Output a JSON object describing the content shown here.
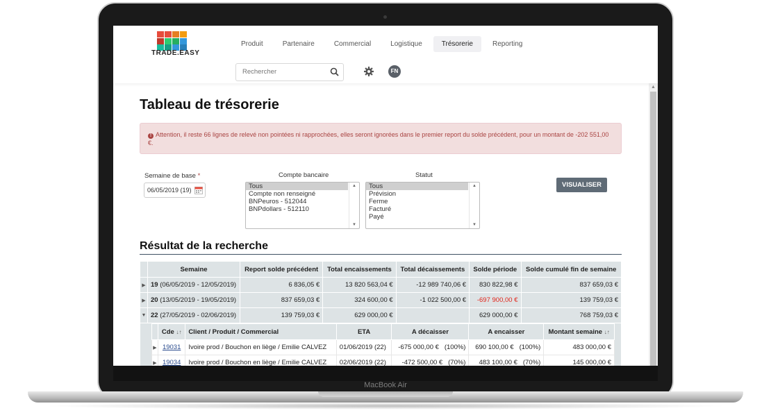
{
  "device": {
    "brand_label": "MacBook Air"
  },
  "logo": {
    "text": "TRADE.EASY",
    "colors": [
      "#e74c3c",
      "#e74c3c",
      "#e67e22",
      "#f39c12",
      "#c0392b",
      "#2ecc71",
      "#27ae60",
      "#3498db",
      "#1abc9c",
      "#16a085",
      "#3498db",
      "#2980b9"
    ]
  },
  "nav": {
    "tabs": [
      {
        "label": "Produit"
      },
      {
        "label": "Partenaire"
      },
      {
        "label": "Commercial"
      },
      {
        "label": "Logistique"
      },
      {
        "label": "Trésorerie",
        "active": true
      },
      {
        "label": "Reporting"
      }
    ]
  },
  "search": {
    "placeholder": "Rechercher"
  },
  "user": {
    "initials": "FN"
  },
  "page": {
    "title": "Tableau de trésorerie"
  },
  "alert": {
    "text": "Attention, il reste 66 lignes de relevé non pointées ni rapprochées, elles seront ignorées dans le premier report du solde précédent, pour un montant de -202 551,00 €."
  },
  "filters": {
    "semaine_label": "Semaine de base",
    "required_mark": "*",
    "semaine_value": "06/05/2019 (19)",
    "compte_label": "Compte bancaire",
    "compte_options": [
      "Tous",
      "Compte non renseigné",
      "BNPeuros - 512044",
      "BNPdollars - 512110"
    ],
    "statut_label": "Statut",
    "statut_options": [
      "Tous",
      "Prévision",
      "Ferme",
      "Facturé",
      "Payé"
    ],
    "button_label": "VISUALISER"
  },
  "results": {
    "title": "Résultat de la recherche",
    "columns": [
      "Semaine",
      "Report solde précédent",
      "Total encaissements",
      "Total décaissements",
      "Solde période",
      "Solde cumulé fin de semaine"
    ],
    "rows": [
      {
        "week": "19",
        "range": "(06/05/2019 - 12/05/2019)",
        "report": "6 836,05 €",
        "enc": "13 820 563,04 €",
        "dec": "-12 989 740,06 €",
        "solde": "830 822,98 €",
        "cumul": "837 659,03 €",
        "negative": false
      },
      {
        "week": "20",
        "range": "(13/05/2019 - 19/05/2019)",
        "report": "837 659,03 €",
        "enc": "324 600,00 €",
        "dec": "-1 022 500,00 €",
        "solde": "-697 900,00 €",
        "cumul": "139 759,03 €",
        "negative": true
      },
      {
        "week": "22",
        "range": "(27/05/2019 - 02/06/2019)",
        "report": "139 759,03 €",
        "enc": "629 000,00 €",
        "dec": "",
        "solde": "629 000,00 €",
        "cumul": "768 759,03 €",
        "negative": false
      }
    ],
    "detail": {
      "columns": [
        "Cde",
        "Client / Produit / Commercial",
        "ETA",
        "A décaisser",
        "A encaisser",
        "Montant semaine"
      ],
      "sort_icon": "↓↑",
      "rows": [
        {
          "cde": "19031",
          "client": "Ivoire prod / Bouchon en liège / Emilie CALVEZ",
          "eta": "01/06/2019 (22)",
          "dec": "-675 000,00 €",
          "dec_pct": "(100%)",
          "enc": "690 100,00 €",
          "enc_pct": "(100%)",
          "montant": "483 000,00 €"
        },
        {
          "cde": "19034",
          "client": "Ivoire prod / Bouchon en liège / Emilie CALVEZ",
          "eta": "02/06/2019 (22)",
          "dec": "-472 500,00 €",
          "dec_pct": "(70%)",
          "enc": "483 100,00 €",
          "enc_pct": "(70%)",
          "montant": "145 000,00 €"
        }
      ]
    }
  }
}
